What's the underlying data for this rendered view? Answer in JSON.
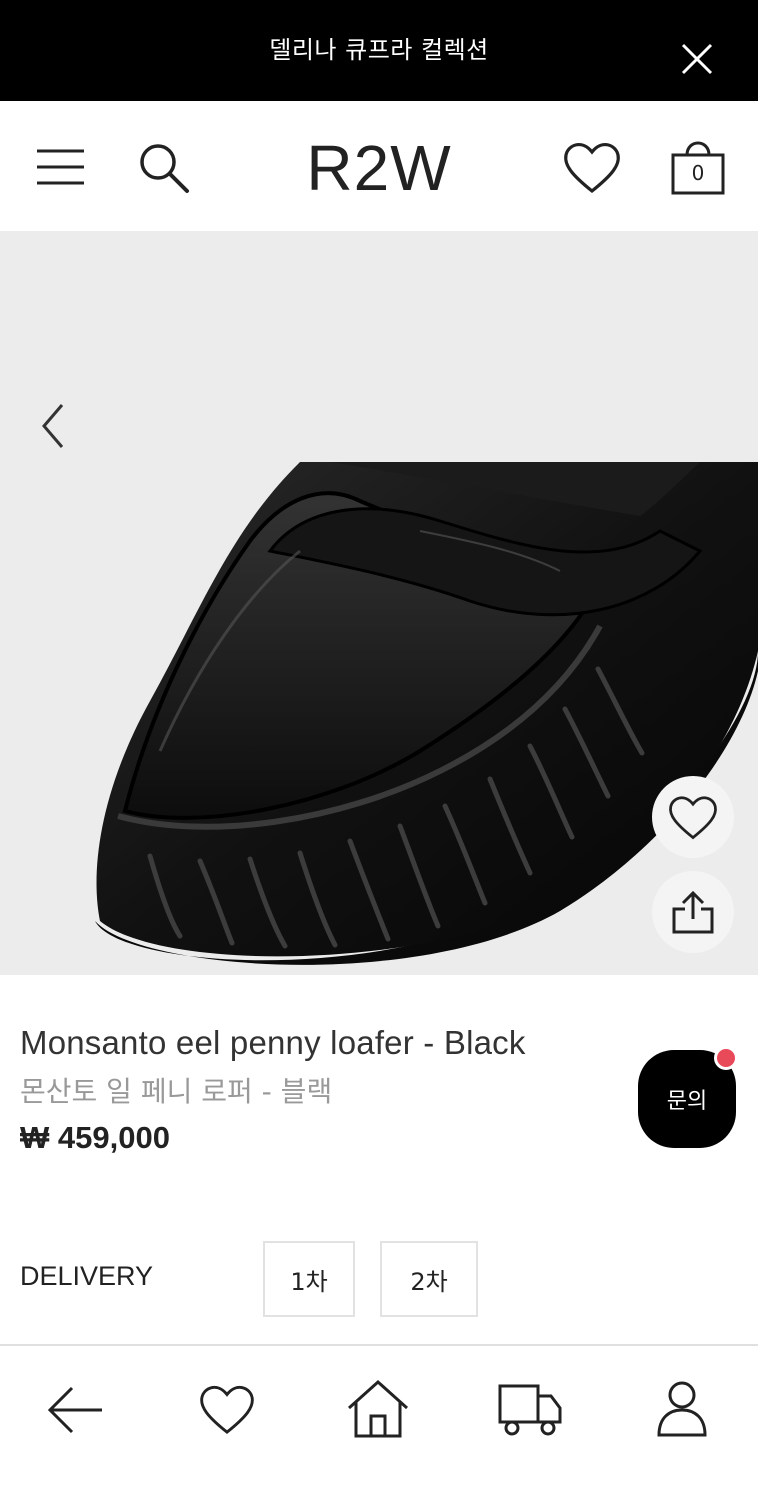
{
  "banner": {
    "text": "델리나 큐프라 컬렉션"
  },
  "header": {
    "logo": "R2W",
    "cart_count": "0"
  },
  "product": {
    "name": "Monsanto eel penny loafer - Black",
    "name_ko": "몬산토 일 페니 로퍼 - 블랙",
    "price": "₩ 459,000"
  },
  "inquiry": {
    "label": "문의"
  },
  "delivery": {
    "label": "DELIVERY",
    "options": [
      "1차",
      "2차"
    ]
  },
  "icons": {
    "banner_close": "close-icon",
    "menu": "menu-icon",
    "search": "search-icon",
    "wishlist": "heart-icon",
    "cart": "bag-icon",
    "prev": "chevron-left-icon",
    "share": "share-icon",
    "nav": [
      "back-arrow-icon",
      "heart-icon",
      "home-icon",
      "truck-icon",
      "user-icon"
    ]
  },
  "colors": {
    "banner_bg": "#000000",
    "notification_dot": "#e84a5a",
    "hero_bg": "#ececec"
  }
}
